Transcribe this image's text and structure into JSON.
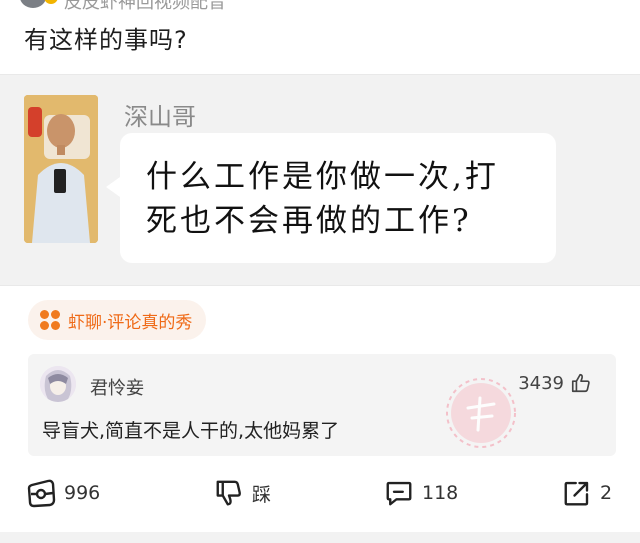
{
  "top": {
    "cut_text": "皮皮虾神回视频配音"
  },
  "post": {
    "title": "有这样的事吗?"
  },
  "quote_card": {
    "author": "深山哥",
    "text": "什么工作是你做一次,打死也不会再做的工作?"
  },
  "tag": {
    "label": "虾聊·评论真的秀"
  },
  "comment": {
    "username": "君怜妾",
    "likes": "3439",
    "text": "导盲犬,简直不是人干的,太他妈累了"
  },
  "actions": {
    "favorite_count": "996",
    "dislike_label": "踩",
    "comment_count": "118",
    "share_count": "2"
  },
  "colors": {
    "accent_orange": "#ef6a17",
    "card_bg": "#f2f2f2",
    "tag_bg": "#fbf2ec"
  }
}
